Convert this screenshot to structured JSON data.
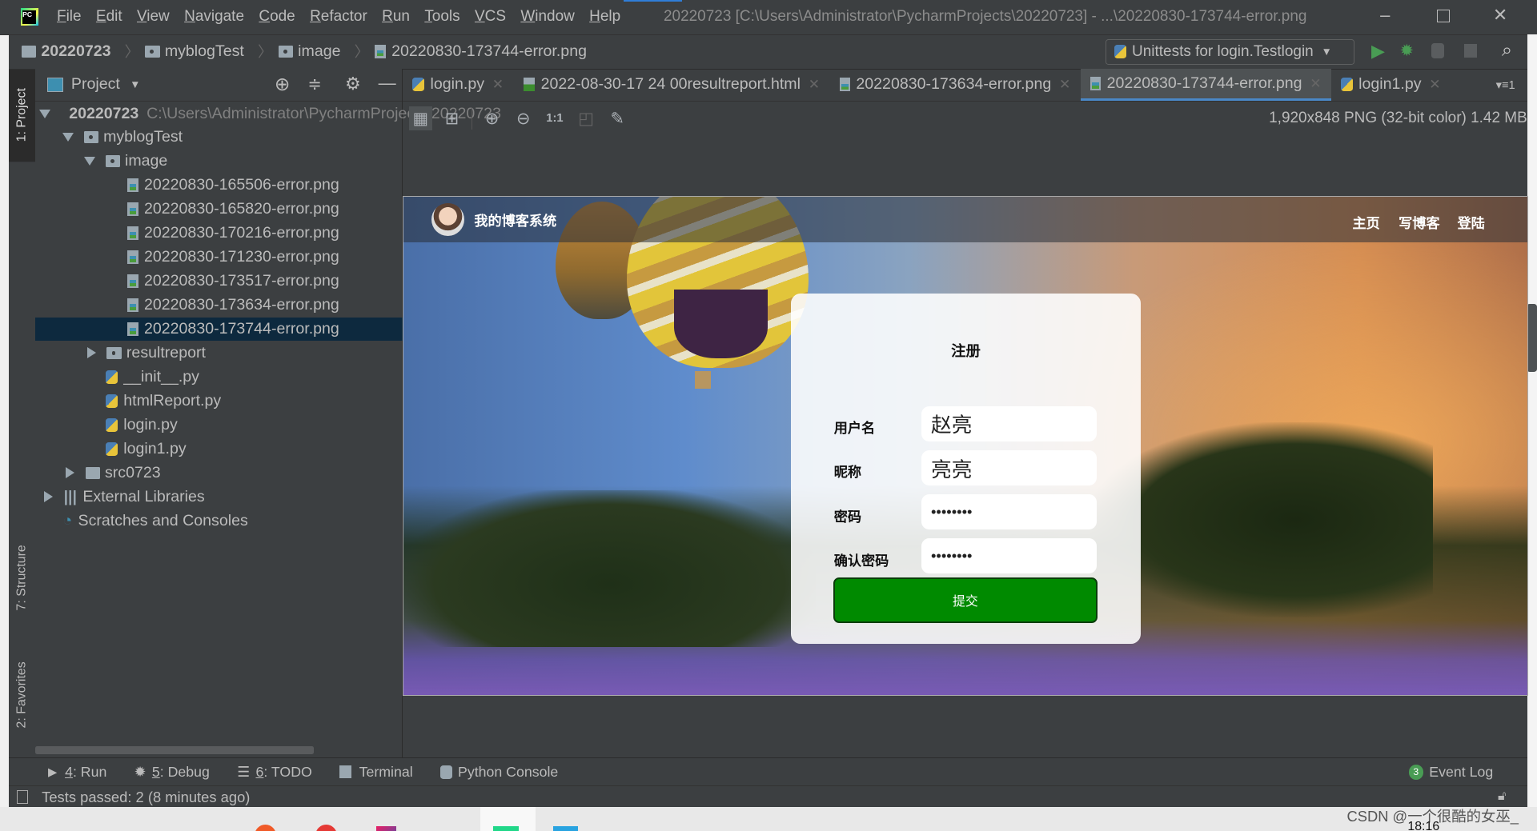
{
  "titlebar": {
    "menu": [
      "File",
      "Edit",
      "View",
      "Navigate",
      "Code",
      "Refactor",
      "Run",
      "Tools",
      "VCS",
      "Window",
      "Help"
    ],
    "title": "20220723 [C:\\Users\\Administrator\\PycharmProjects\\20220723] - ...\\20220830-173744-error.png"
  },
  "breadcrumb": [
    "20220723",
    "myblogTest",
    "image",
    "20220830-173744-error.png"
  ],
  "run_config": "Unittests for login.Testlogin",
  "left_strip": {
    "project": "1: Project",
    "structure": "7: Structure",
    "favorites": "2: Favorites"
  },
  "project_panel": {
    "title": "Project",
    "root": {
      "name": "20220723",
      "path": "C:\\Users\\Administrator\\PycharmProjects\\20220723"
    },
    "items": [
      {
        "label": "myblogTest",
        "type": "module",
        "level": 1,
        "expanded": true
      },
      {
        "label": "image",
        "type": "module",
        "level": 2,
        "expanded": true
      },
      {
        "label": "20220830-165506-error.png",
        "type": "image",
        "level": 3
      },
      {
        "label": "20220830-165820-error.png",
        "type": "image",
        "level": 3
      },
      {
        "label": "20220830-170216-error.png",
        "type": "image",
        "level": 3
      },
      {
        "label": "20220830-171230-error.png",
        "type": "image",
        "level": 3
      },
      {
        "label": "20220830-173517-error.png",
        "type": "image",
        "level": 3
      },
      {
        "label": "20220830-173634-error.png",
        "type": "image",
        "level": 3
      },
      {
        "label": "20220830-173744-error.png",
        "type": "image",
        "level": 3,
        "selected": true
      },
      {
        "label": "resultreport",
        "type": "module",
        "level": 2,
        "expanded": false
      },
      {
        "label": "__init__.py",
        "type": "python",
        "level": 2
      },
      {
        "label": "htmlReport.py",
        "type": "python",
        "level": 2
      },
      {
        "label": "login.py",
        "type": "python",
        "level": 2
      },
      {
        "label": "login1.py",
        "type": "python",
        "level": 2
      },
      {
        "label": "src0723",
        "type": "folder",
        "level": 1,
        "expanded": false
      },
      {
        "label": "External Libraries",
        "type": "libs",
        "level": 0,
        "expanded": false
      },
      {
        "label": "Scratches and Consoles",
        "type": "scratch",
        "level": 0
      }
    ]
  },
  "tabs": [
    {
      "label": "login.py",
      "type": "python"
    },
    {
      "label": "2022-08-30-17 24 00resultreport.html",
      "type": "html"
    },
    {
      "label": "20220830-173634-error.png",
      "type": "image"
    },
    {
      "label": "20220830-173744-error.png",
      "type": "image",
      "active": true
    },
    {
      "label": "login1.py",
      "type": "python"
    }
  ],
  "tabs_overflow": "1",
  "image_info": "1,920x848 PNG (32-bit color) 1.42 MB",
  "image_toolbar": {
    "actual_size": "1:1"
  },
  "blog": {
    "site_title": "我的博客系统",
    "nav": [
      "主页",
      "写博客",
      "登陆"
    ],
    "form": {
      "title": "注册",
      "fields": [
        {
          "label": "用户名",
          "value": "赵亮"
        },
        {
          "label": "昵称",
          "value": "亮亮"
        },
        {
          "label": "密码",
          "value": "••••••••"
        },
        {
          "label": "确认密码",
          "value": "••••••••"
        }
      ],
      "submit": "提交"
    }
  },
  "bottom_tools": [
    {
      "key": "4",
      "label": ": Run"
    },
    {
      "key": "5",
      "label": ": Debug"
    },
    {
      "key": "6",
      "label": ": TODO"
    },
    {
      "key": "",
      "label": "Terminal"
    },
    {
      "key": "",
      "label": "Python Console"
    }
  ],
  "event_log": {
    "count": "3",
    "label": "Event Log"
  },
  "status": "Tests passed: 2 (8 minutes ago)",
  "watermark": "CSDN @一个很酷的女巫_",
  "clock": "18:16",
  "colors": {
    "accent": "#4a88c7",
    "selection": "#0d293e",
    "submit": "#008a00",
    "run": "#499c54"
  }
}
